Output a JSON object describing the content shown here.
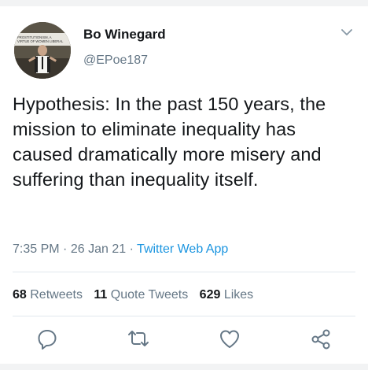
{
  "tweet": {
    "display_name": "Bo Winegard",
    "handle": "@EPoe187",
    "avatar_sign": "PROSTITUTIONISM, A\nVIRTUE OF WOMEN LIBERAL",
    "text": "Hypothesis: In the past 150 years, the mission to eliminate inequality has caused dramatically more misery and suffering than inequality itself.",
    "time": "7:35 PM",
    "date": "26 Jan 21",
    "separator": "·",
    "app": "Twitter Web App"
  },
  "stats": {
    "retweets_count": "68",
    "retweets_label": "Retweets",
    "quotes_count": "11",
    "quotes_label": "Quote Tweets",
    "likes_count": "629",
    "likes_label": "Likes"
  },
  "icons": {
    "reply": "reply-icon",
    "retweet": "retweet-icon",
    "like": "like-icon",
    "share": "share-icon",
    "menu": "chevron-down-icon"
  },
  "colors": {
    "text": "#14171a",
    "secondary": "#657786",
    "link": "#1b95e0",
    "divider": "#e1e8ed"
  }
}
